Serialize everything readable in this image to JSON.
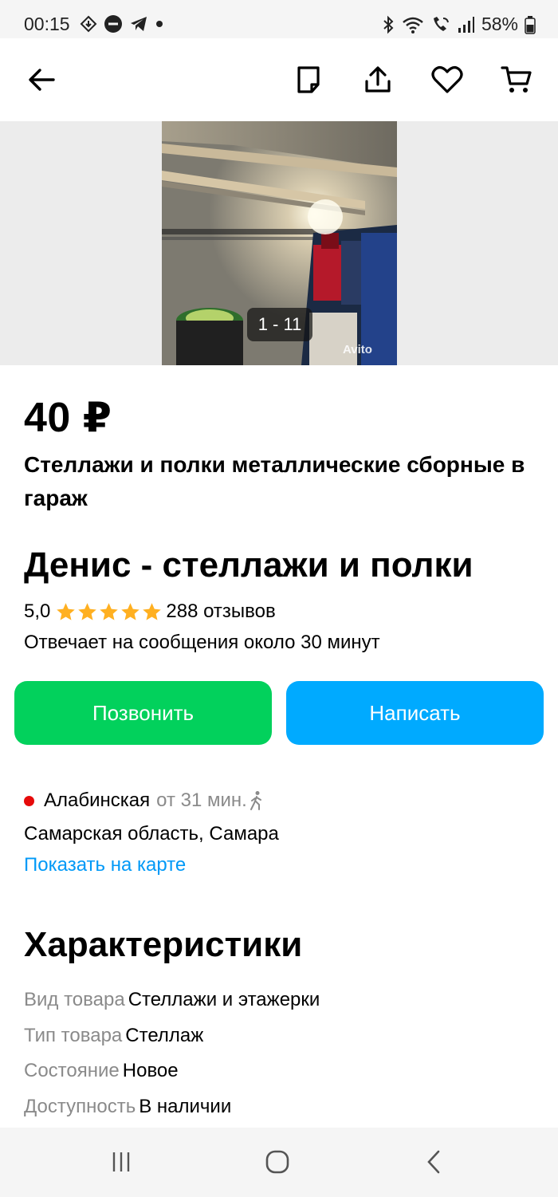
{
  "status_bar": {
    "time": "00:15",
    "battery": "58%",
    "icons": [
      "download-icon",
      "dnd-icon",
      "telegram-icon",
      "notification-dot-icon",
      "bluetooth-icon",
      "wifi-icon",
      "wifi-calling-icon",
      "signal-icon",
      "battery-icon"
    ]
  },
  "header": {
    "icons": [
      "back-arrow-icon",
      "note-icon",
      "share-icon",
      "heart-icon",
      "cart-icon"
    ]
  },
  "gallery": {
    "counter": "1 - 11",
    "watermark": "Avito"
  },
  "listing": {
    "price": "40 ₽",
    "title": "Стеллажи и полки металлические сборные в гараж"
  },
  "seller": {
    "name": "Денис - стеллажи и полки",
    "rating": "5,0",
    "stars": 5,
    "reviews": "288 отзывов",
    "response_time": "Отвечает на сообщения около 30 минут"
  },
  "actions": {
    "call_label": "Позвонить",
    "write_label": "Написать"
  },
  "location": {
    "metro": "Алабинская",
    "metro_time": "от 31 мин.",
    "address": "Самарская область, Самара",
    "map_link": "Показать на карте"
  },
  "characteristics": {
    "title": "Характеристики",
    "items": [
      {
        "key": "Вид товара",
        "value": "Стеллажи и этажерки"
      },
      {
        "key": "Тип товара",
        "value": "Стеллаж"
      },
      {
        "key": "Состояние",
        "value": "Новое"
      },
      {
        "key": "Доступность",
        "value": "В наличии"
      }
    ]
  },
  "colors": {
    "call_green": "#02d15c",
    "write_blue": "#00aaff",
    "link_blue": "#0099f7",
    "star_gold": "#ffb021",
    "metro_red": "#e60a0a"
  }
}
